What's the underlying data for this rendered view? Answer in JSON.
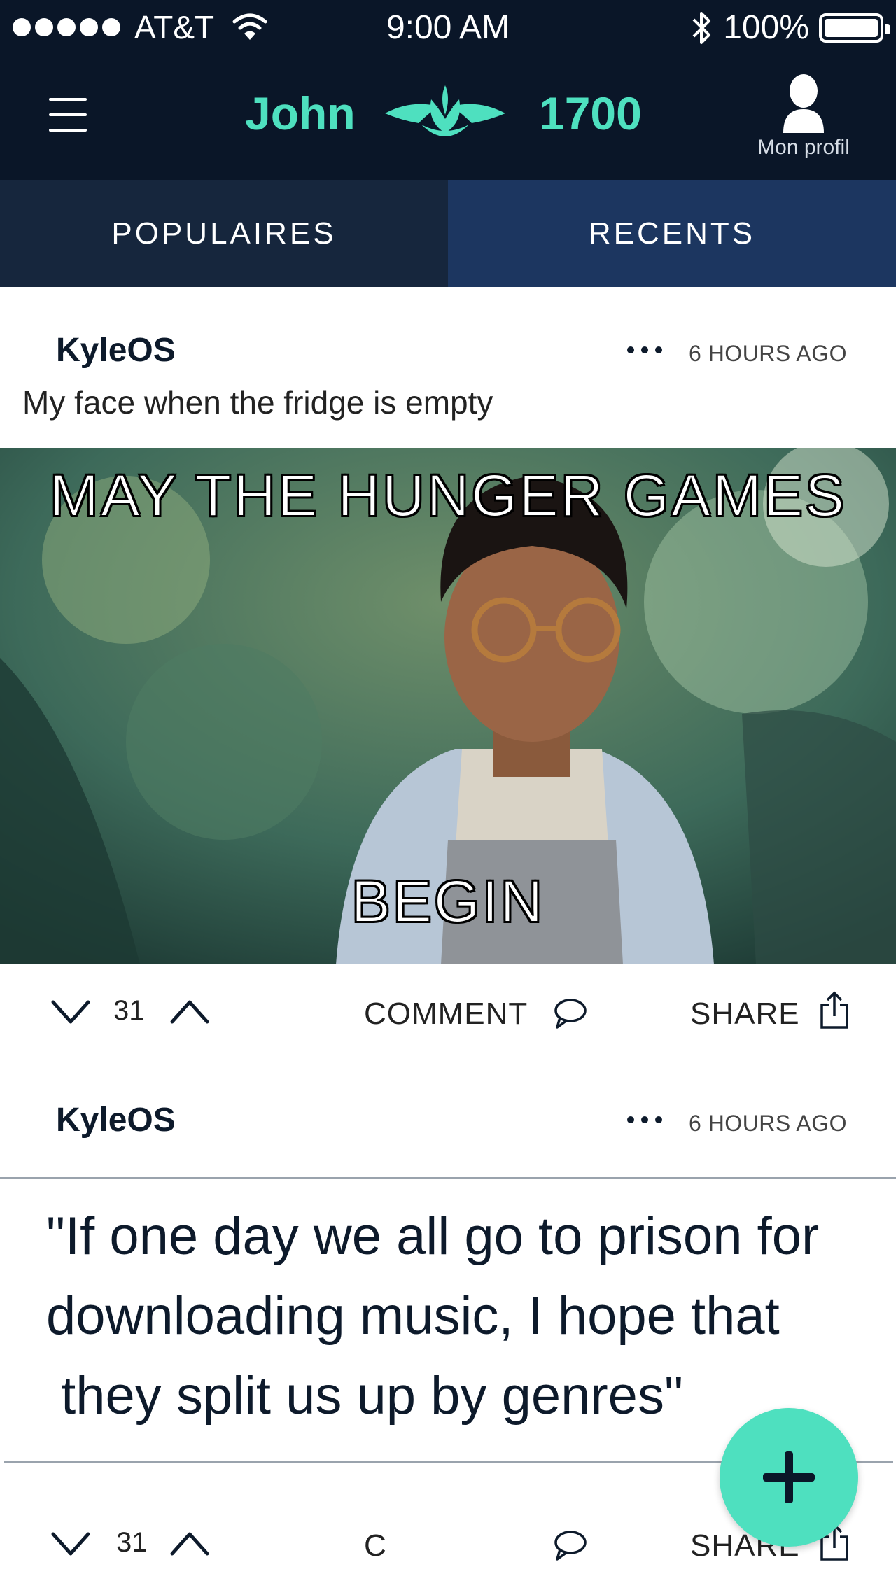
{
  "status_bar": {
    "carrier": "AT&T",
    "time": "9:00 AM",
    "battery": "100%"
  },
  "header": {
    "user_name": "John",
    "points": "1700",
    "profile_label": "Mon profil"
  },
  "tabs": [
    {
      "label": "POPULAIRES"
    },
    {
      "label": "RECENTS"
    }
  ],
  "posts": [
    {
      "author": "KyleOS",
      "time": "6 HOURS AGO",
      "caption": "My face when the fridge is empty",
      "meme_top": "MAY THE HUNGER GAMES",
      "meme_bottom": "BEGIN",
      "votes": "31",
      "comment_label": "COMMENT",
      "share_label": "SHARE"
    },
    {
      "author": "KyleOS",
      "time": "6 HOURS AGO",
      "quote_lines": [
        "\"If one day we all go to prison for",
        "downloading music, I hope that",
        " they split us up by genres\""
      ],
      "votes": "31",
      "comment_label": "C",
      "share_label": "SHARE"
    }
  ],
  "colors": {
    "accent": "#4ee0bf",
    "navy": "#0a1628",
    "tab_left": "#16263d",
    "tab_right": "#1c3660"
  },
  "icons": [
    "menu-icon",
    "lotus-logo-icon",
    "profile-icon",
    "more-icon",
    "downvote-icon",
    "upvote-icon",
    "comment-icon",
    "share-icon",
    "plus-icon"
  ]
}
